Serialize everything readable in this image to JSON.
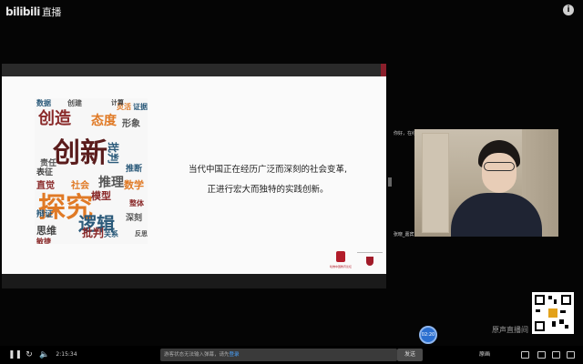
{
  "app": {
    "logo_text": "bilibili",
    "live_label": "直播"
  },
  "slide": {
    "line1": "当代中国正在经历广泛而深刻的社会变革,",
    "line2": "正进行宏大而独特的实践创新。",
    "logo1_caption": "哈佛中国教育论坛",
    "wordcloud": [
      "创新",
      "探究",
      "创造",
      "逻辑",
      "推理",
      "态度",
      "批判",
      "思维",
      "模型",
      "形象",
      "批判",
      "数学",
      "直觉",
      "社会",
      "责任",
      "证据",
      "表征",
      "辩证",
      "敏捷",
      "深刻",
      "数据",
      "灵活",
      "推断",
      "创建",
      "关系",
      "整体",
      "计算",
      "反思"
    ]
  },
  "camera": {
    "label": "你好，在线观看",
    "name": "张晓_嘉宾"
  },
  "float_button": "02:20",
  "watermark": "原声直播间",
  "controls": {
    "time": "2:15:34",
    "danmaku_placeholder": "游客状态无法输入弹幕，请先",
    "danmaku_link": "登录",
    "send_label": "发送",
    "quality_label": "原画"
  },
  "colors": {
    "accent_red": "#8a1f2b",
    "brand_blue": "#2b6fd0",
    "orange": "#e07a26"
  }
}
